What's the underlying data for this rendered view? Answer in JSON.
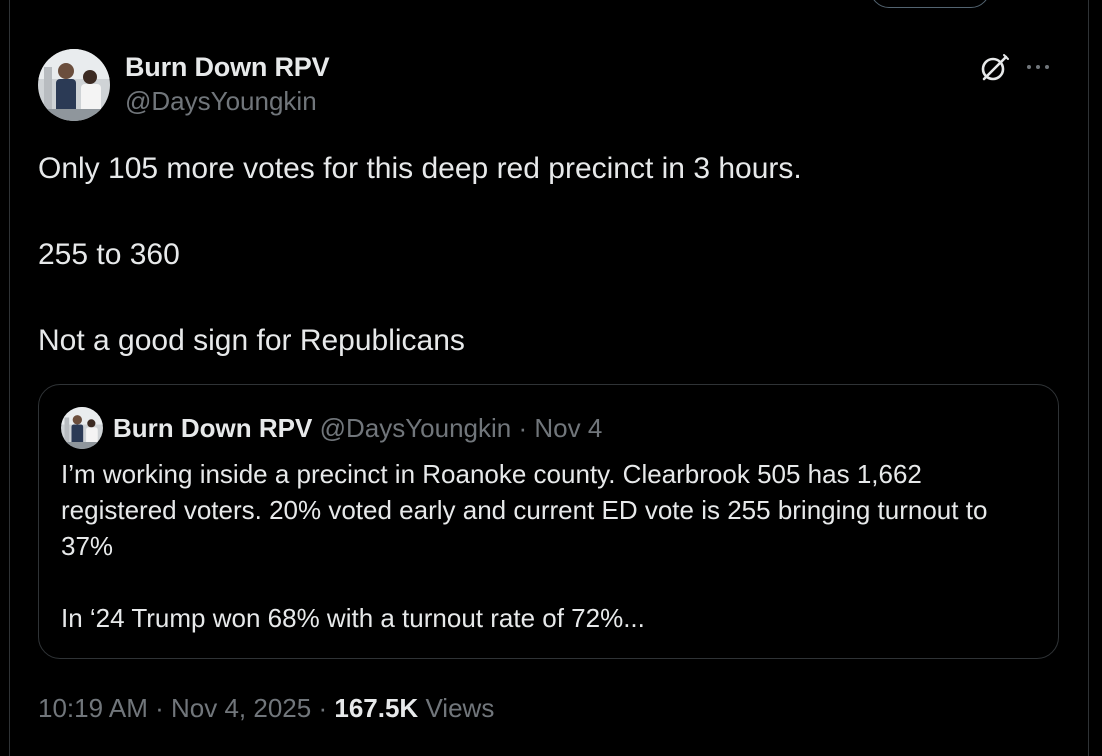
{
  "tweet": {
    "display_name": "Burn Down RPV",
    "handle": "@DaysYoungkin",
    "lines": [
      "Only 105 more votes for this deep red precinct in 3 hours.",
      "255 to 360",
      "Not a good sign for Republicans"
    ],
    "time": "10:19 AM",
    "separator": "·",
    "date": "Nov 4, 2025",
    "views_count": "167.5K",
    "views_label": "Views"
  },
  "quoted": {
    "display_name": "Burn Down RPV",
    "handle": "@DaysYoungkin",
    "separator": "·",
    "date": "Nov 4",
    "lines": [
      "I’m working inside a precinct in Roanoke county. Clearbrook 505 has 1,662 registered voters. 20% voted early and current ED vote is 255 bringing turnout to 37%",
      "In ‘24 Trump won 68% with a turnout rate of 72%..."
    ]
  },
  "icons": {
    "grok": "grok-icon",
    "more": "more-icon"
  },
  "colors": {
    "background": "#000000",
    "text": "#e7e9ea",
    "secondary": "#71767b",
    "border": "#2f3336"
  }
}
